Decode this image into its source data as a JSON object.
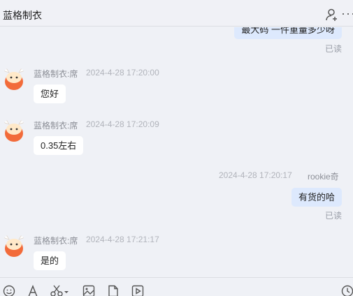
{
  "header": {
    "title": "蓝格制衣",
    "icons": [
      "add-contact-icon",
      "more-icon"
    ],
    "more_glyph": "···"
  },
  "messages": {
    "top_partial": {
      "text": "最大码 一件重量多少呀",
      "status": "已读"
    },
    "m1": {
      "sender": "蓝格制衣:席",
      "time": "2024-4-28 17:20:00",
      "text": "您好"
    },
    "m2": {
      "sender": "蓝格制衣:席",
      "time": "2024-4-28 17:20:09",
      "text": "0.35左右"
    },
    "m3": {
      "sender": "rookie奇",
      "time": "2024-4-28 17:20:17",
      "text": "有货的哈",
      "status": "已读"
    },
    "m4": {
      "sender": "蓝格制衣:席",
      "time": "2024-4-28 17:21:17",
      "text": "是的"
    }
  },
  "toolbar": {
    "icons": [
      "emoji-icon",
      "font-icon",
      "screenshot-icon",
      "image-icon",
      "file-icon",
      "video-icon",
      "history-icon"
    ]
  },
  "colors": {
    "background": "#eff1f6",
    "incoming_bubble": "#ffffff",
    "outgoing_bubble": "#dde9fd",
    "avatar_orange": "#f26b3a"
  }
}
